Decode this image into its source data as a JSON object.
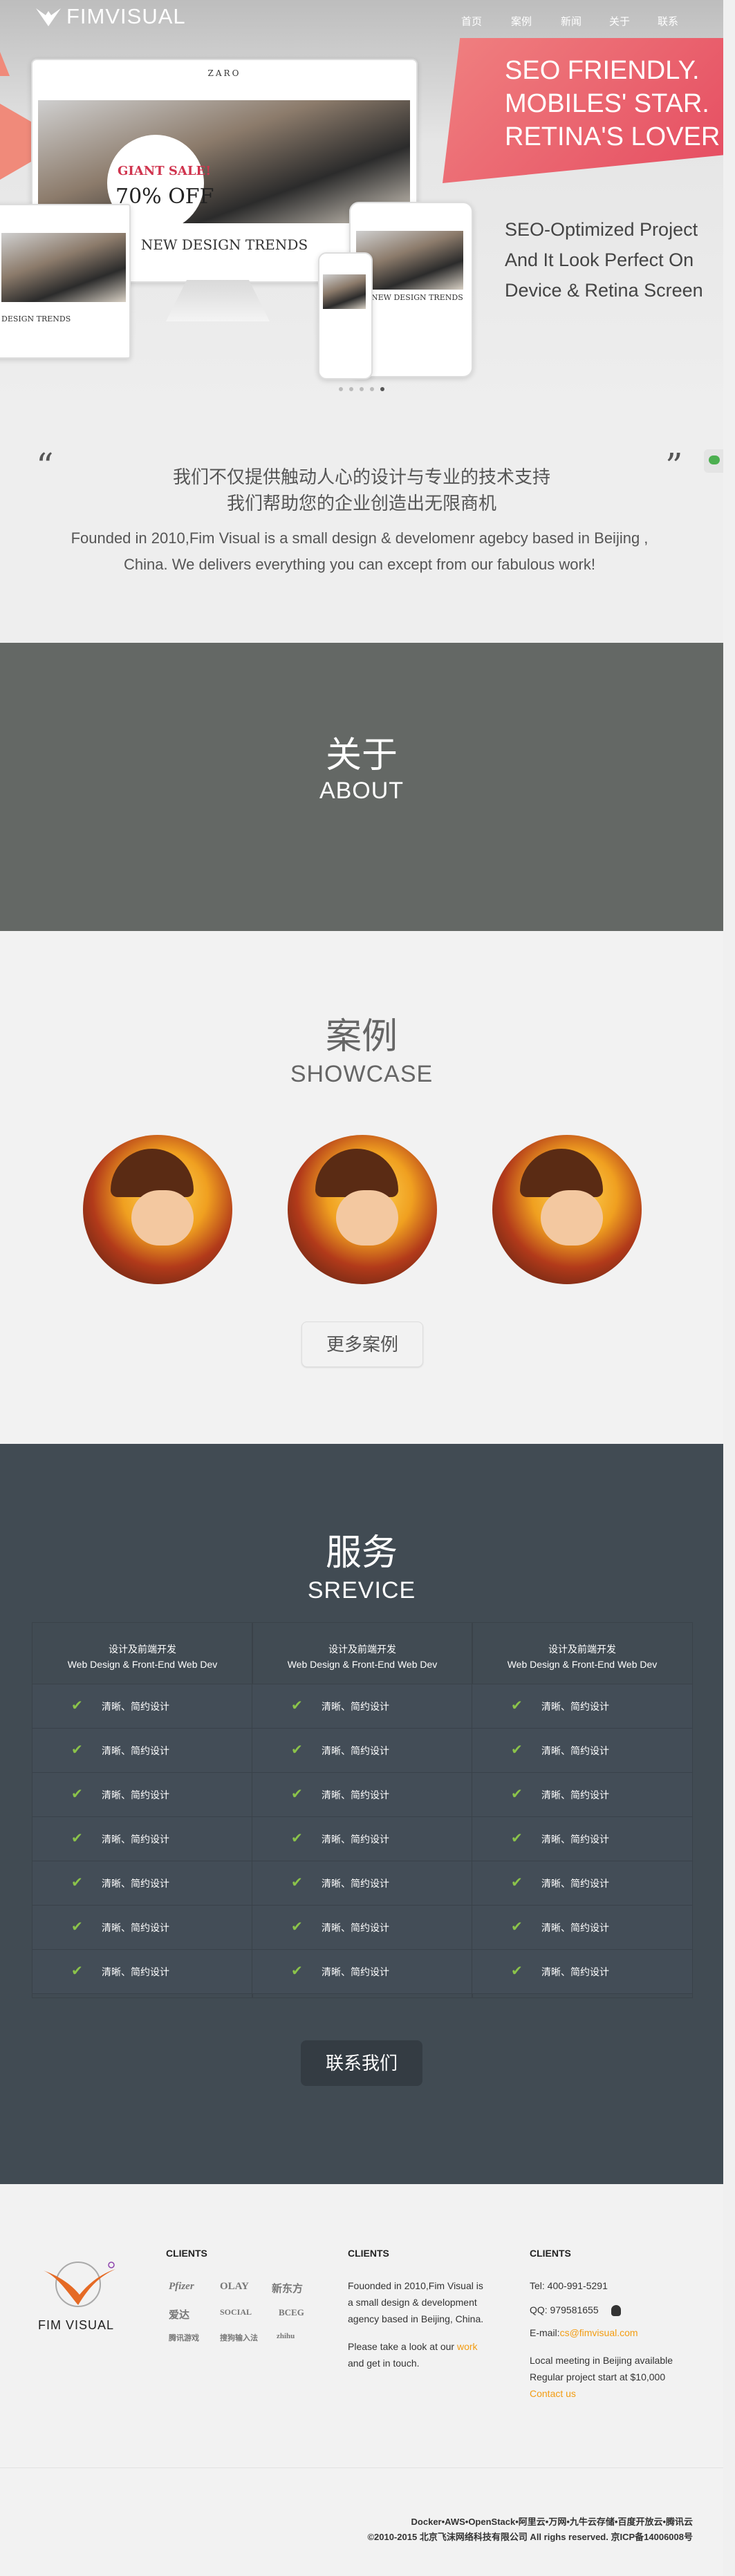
{
  "brand": {
    "name": "FIMVISUAL",
    "footer_name": "FIM VISUAL"
  },
  "nav": {
    "items": [
      {
        "label": "首页"
      },
      {
        "label": "案例"
      },
      {
        "label": "新闻"
      },
      {
        "label": "关于"
      },
      {
        "label": "联系"
      }
    ]
  },
  "hero": {
    "headline": [
      "SEO FRIENDLY.",
      "MOBILES' STAR.",
      "RETINA'S LOVER"
    ],
    "sub": [
      "SEO-Optimized Project",
      "And It Look Perfect On",
      "Device & Retina Screen"
    ],
    "mock": {
      "site": "ZARO",
      "sale": "GIANT SALE!",
      "off": "70% OFF",
      "trend": "NEW DESIGN TRENDS"
    }
  },
  "intro": {
    "zh_1": "我们不仅提供触动人心的设计与专业的技术支持",
    "zh_2": "我们帮助您的企业创造出无限商机",
    "en_1": "Founded in 2010,Fim Visual is a small design & develomenr agebcy based in Beijing ,",
    "en_2": "China. We delivers everything you can except from our fabulous work!"
  },
  "about": {
    "zh": "关于",
    "en": "ABOUT",
    "bg": "#646865"
  },
  "showcase": {
    "zh": "案例",
    "en": "SHOWCASE",
    "more": "更多案例"
  },
  "service": {
    "zh": "服务",
    "en": "SREVICE",
    "bg": "#414b53",
    "columns": [
      {
        "title_zh": "设计及前端开发",
        "title_en": "Web Design & Front-End Web Dev"
      },
      {
        "title_zh": "设计及前端开发",
        "title_en": "Web Design & Front-End Web Dev"
      },
      {
        "title_zh": "设计及前端开发",
        "title_en": "Web Design & Front-End Web Dev"
      }
    ],
    "feature": "清晰、简约设计",
    "contact_btn": "联系我们"
  },
  "footer": {
    "clients_heading": "CLIENTS",
    "about_heading": "CLIENTS",
    "contact_heading": "CLIENTS",
    "client_logos": [
      "Pfizer",
      "OLAY",
      "新东方",
      "爱达",
      "SOCIAL",
      "BCEG",
      "腾讯游戏",
      "搜狗输入法",
      "zhihu"
    ],
    "about_text": [
      "Fouonded in 2010,Fim Visual is",
      "a small design & development",
      "agency based in Beijing, China."
    ],
    "work_text_pre": "Please take a look at our ",
    "work_link": "work",
    "work_text_post": "and get in touch.",
    "tel": "Tel: 400-991-5291",
    "qq": "QQ: 979581655",
    "email_label": "E-mail:",
    "email": "cs@fimvisual.com",
    "meeting": "Local meeting in Beijing available",
    "regular": "Regular project start at $10,000",
    "contact_link": "Contact us",
    "stack": "Docker•AWS•OpenStack•阿里云•万网•九牛云存储•百度开放云•腾讯云",
    "copyright": "©2010-2015 北京飞沫网络科技有限公司 All righs reserved. 京ICP备14006008号"
  },
  "colors": {
    "accent": "#f39c12",
    "banner": "#e85a6a",
    "check": "#8bc34a"
  }
}
